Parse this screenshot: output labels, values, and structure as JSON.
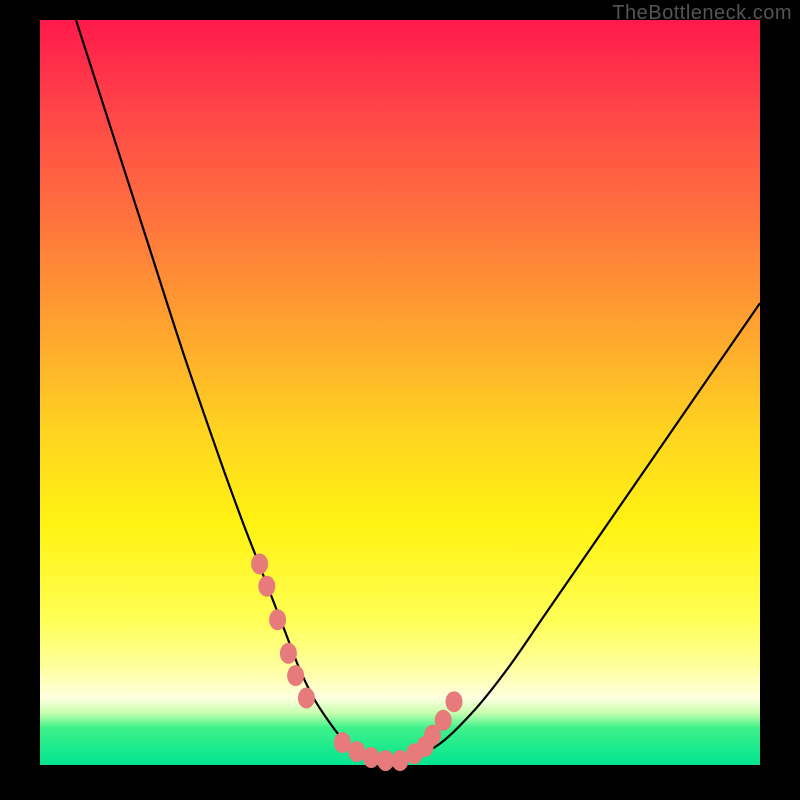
{
  "watermark": "TheBottleneck.com",
  "colors": {
    "gradient_top": "#ff1a4b",
    "gradient_bottom": "#00e590",
    "marker": "#e77a7a",
    "curve": "#000000",
    "frame": "#000000"
  },
  "chart_data": {
    "type": "line",
    "title": "",
    "xlabel": "",
    "ylabel": "",
    "xlim": [
      0,
      100
    ],
    "ylim": [
      0,
      100
    ],
    "series": [
      {
        "name": "bottleneck-curve",
        "x": [
          5,
          10,
          15,
          20,
          25,
          28,
          30,
          32,
          34,
          36,
          38,
          40,
          42,
          44,
          46,
          48,
          50,
          55,
          60,
          65,
          70,
          75,
          80,
          85,
          90,
          95,
          100
        ],
        "y": [
          100,
          85,
          70,
          55,
          41,
          33,
          28,
          23,
          18,
          13,
          9,
          6,
          3.5,
          2,
          1.2,
          0.6,
          0.6,
          2.5,
          7,
          13,
          20,
          27,
          34,
          41,
          48,
          55,
          62
        ]
      }
    ],
    "markers": {
      "name": "highlight-points",
      "x": [
        30.5,
        31.5,
        33,
        34.5,
        35.5,
        37,
        42,
        44,
        46,
        48,
        50,
        52,
        53.5,
        54.5,
        56,
        57.5
      ],
      "y": [
        27,
        24,
        19.5,
        15,
        12,
        9,
        3,
        1.8,
        1,
        0.6,
        0.6,
        1.5,
        2.5,
        4,
        6,
        8.5
      ]
    }
  }
}
